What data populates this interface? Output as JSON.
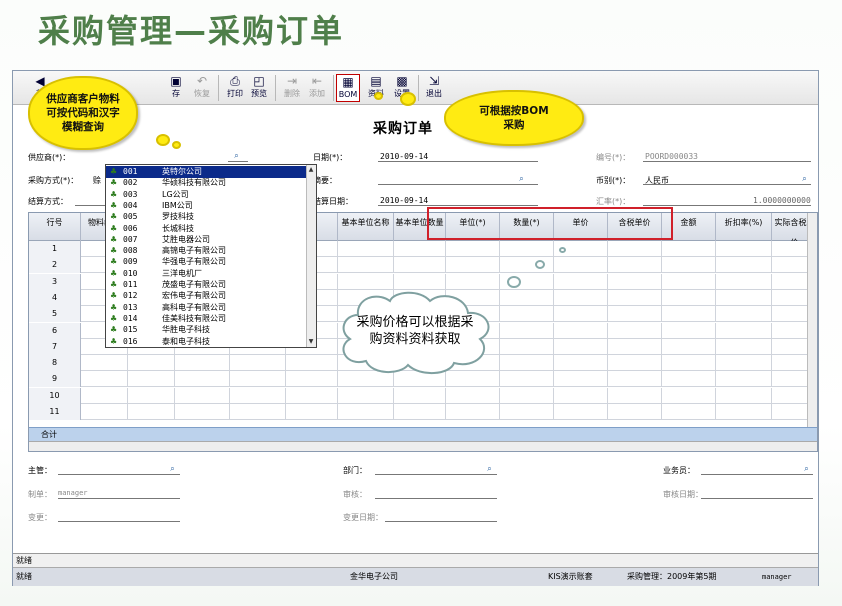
{
  "slide_title": "采购管理—采购订单",
  "toolbar": {
    "buttons": [
      {
        "label": "前",
        "icon": "arrow-left-icon",
        "enabled": true
      },
      {
        "label": "存",
        "icon": "save-icon",
        "enabled": true
      },
      {
        "label": "恢复",
        "icon": "undo-icon",
        "enabled": false
      },
      {
        "label": "打印",
        "icon": "printer-icon",
        "enabled": true
      },
      {
        "label": "预览",
        "icon": "preview-icon",
        "enabled": true
      },
      {
        "label": "删除",
        "icon": "delete-row-icon",
        "enabled": false
      },
      {
        "label": "添加",
        "icon": "add-row-icon",
        "enabled": false
      },
      {
        "label": "BOM",
        "icon": "bom-icon",
        "enabled": true
      },
      {
        "label": "资料",
        "icon": "data-icon",
        "enabled": true
      },
      {
        "label": "设置",
        "icon": "settings-icon",
        "enabled": true
      },
      {
        "label": "退出",
        "icon": "exit-icon",
        "enabled": true
      }
    ]
  },
  "form": {
    "title": "采购订单",
    "supplier_label": "供应商(*)：",
    "purchase_method_label": "采购方式(*)：",
    "purchase_method_value": "赊",
    "settlement_label": "结算方式：",
    "date_label": "日期(*)：",
    "date_value": "2010-09-14",
    "summary_label": "摘要：",
    "settle_date_label": "结算日期：",
    "settle_date_value": "2010-09-14",
    "number_label": "编号(*)：",
    "number_value": "POORD000033",
    "currency_label": "币别(*)：",
    "currency_value": "人民币",
    "rate_label": "汇率(*)：",
    "rate_value": "1.0000000000"
  },
  "grid": {
    "columns": [
      "行号",
      "物料编码",
      "",
      "",
      "",
      "",
      "基本单位名称",
      "基本单位数量",
      "单位(*)",
      "数量(*)",
      "单价",
      "含税单价",
      "金额",
      "折扣率(%)",
      "实际含税单价"
    ],
    "row_numbers": [
      "1",
      "2",
      "3",
      "4",
      "5",
      "6",
      "7",
      "8",
      "9",
      "10",
      "11"
    ],
    "sum_label": "合计"
  },
  "dropdown": {
    "items": [
      {
        "code": "001",
        "name": "英特尔公司"
      },
      {
        "code": "002",
        "name": "华硕科技有限公司"
      },
      {
        "code": "003",
        "name": "LG公司"
      },
      {
        "code": "004",
        "name": "IBM公司"
      },
      {
        "code": "005",
        "name": "罗技科技"
      },
      {
        "code": "006",
        "name": "长城科技"
      },
      {
        "code": "007",
        "name": "艾胜电器公司"
      },
      {
        "code": "008",
        "name": "高锦电子有限公司"
      },
      {
        "code": "009",
        "name": "华强电子有限公司"
      },
      {
        "code": "010",
        "name": "三洋电机厂"
      },
      {
        "code": "011",
        "name": "茂盛电子有限公司"
      },
      {
        "code": "012",
        "name": "宏伟电子有限公司"
      },
      {
        "code": "013",
        "name": "高科电子有限公司"
      },
      {
        "code": "014",
        "name": "佳美科技有限公司"
      },
      {
        "code": "015",
        "name": "华胜电子科技"
      },
      {
        "code": "016",
        "name": "泰和电子科技"
      }
    ]
  },
  "footer": {
    "supervisor_label": "主管：",
    "department_label": "部门：",
    "salesperson_label": "业务员：",
    "maker_label": "制单：",
    "maker_value": "manager",
    "auditor_label": "审核：",
    "audit_date_label": "审核日期：",
    "changer_label": "变更：",
    "change_date_label": "变更日期："
  },
  "status": {
    "line1": "就绪",
    "line2_left": "就绪",
    "company": "金华电子公司",
    "account": "KIS演示账套",
    "period": "采购管理：2009年第5期",
    "user": "manager"
  },
  "callouts": {
    "supplier_tip": "供应商客户物料可按代码和汉字模糊查询",
    "bom_tip": "可根据按BOM采购",
    "price_tip": "采购价格可以根据采购资料资料获取"
  },
  "colors": {
    "title_green": "#4f7f4a",
    "bubble_yellow": "#ffeb12",
    "highlight_red": "#d0202a",
    "selected_row": "#0b2a8a",
    "sum_row": "#bcd2ec"
  }
}
